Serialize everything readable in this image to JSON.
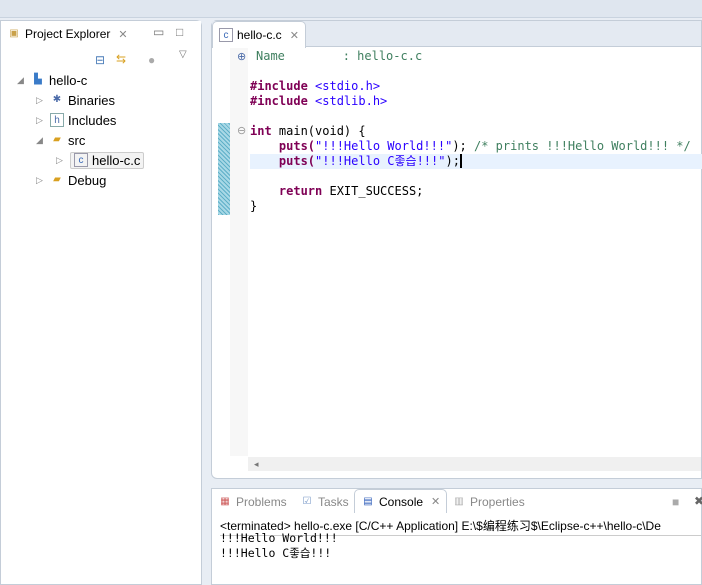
{
  "explorer": {
    "title": "Project Explorer",
    "project": "hello-c",
    "items": [
      "Binaries",
      "Includes",
      "src",
      "hello-c.c",
      "Debug"
    ]
  },
  "editor": {
    "tab": "hello-c.c",
    "lines": {
      "name_label": "Name",
      "name_value": ": hello-c.c",
      "inc1": "#include",
      "inc1f": "<stdio.h>",
      "inc2": "#include",
      "inc2f": "<stdlib.h>",
      "l1kw": "int",
      "l1": " main(void) {",
      "l2a": "    puts(",
      "l2s": "\"!!!Hello World!!!\"",
      "l2b": "); ",
      "l2c": "/* prints !!!Hello World!!! */",
      "l3a": "    puts(",
      "l3s": "\"!!!Hello C좋습!!!\"",
      "l3b": ");",
      "l4kw": "    return",
      "l4": " EXIT_SUCCESS;",
      "l5": "}"
    }
  },
  "bottom": {
    "tabs": [
      "Problems",
      "Tasks",
      "Console",
      "Properties"
    ],
    "active": "Console",
    "status": "<terminated> hello-c.exe [C/C++ Application] E:\\$编程练习$\\Eclipse-c++\\hello-c\\De",
    "output": [
      "!!!Hello World!!!",
      "!!!Hello C좋습!!!"
    ]
  }
}
